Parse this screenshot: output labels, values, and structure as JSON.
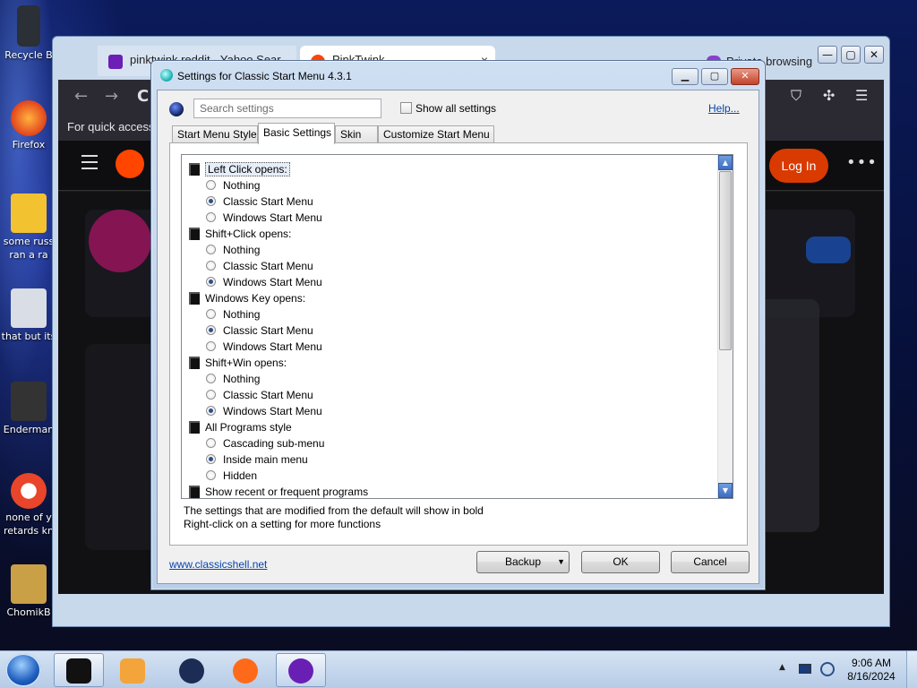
{
  "desktop": {
    "icons": [
      {
        "label": "Recycle B",
        "color": "#2b2f36"
      },
      {
        "label": "Firefox",
        "color": "#ff7a1a"
      },
      {
        "label": "some russ",
        "label2": "ran a ra",
        "color": "#f2c230"
      },
      {
        "label": "that but its",
        "color": "#d8dde6"
      },
      {
        "label": "Enderman",
        "color": "#333333"
      },
      {
        "label": "none of y",
        "label2": "retards kn",
        "color": "#e8452a"
      },
      {
        "label": "ChomikB",
        "color": "#c9a045"
      }
    ]
  },
  "browser": {
    "tab1": {
      "title": "pinktwink reddit - Yahoo Sear",
      "favicon_color": "#6b1fb4"
    },
    "tab2": {
      "title": "PinkTwink",
      "close": "×"
    },
    "private_label": "Private browsing",
    "window_buttons": {
      "minimize": "—",
      "maximize": "▢",
      "close": "✕"
    },
    "nav": {
      "back": "←",
      "forward": "→",
      "reload": "C"
    },
    "quick_access_text": "For quick access,",
    "reddit": {
      "login_label": "Log In",
      "more": "•••",
      "brand_color": "#ff4500"
    }
  },
  "dialog": {
    "title": "Settings for Classic Start Menu 4.3.1",
    "buttons": {
      "minimize": "▁",
      "maximize": "▢",
      "close": "✕"
    },
    "search": {
      "placeholder": "Search settings",
      "value": ""
    },
    "show_all_label": "Show all settings",
    "help_label": "Help...",
    "tabs": [
      {
        "label": "Start Menu Style",
        "active": false
      },
      {
        "label": "Basic Settings",
        "active": true
      },
      {
        "label": "Skin",
        "active": false
      },
      {
        "label": "Customize Start Menu",
        "active": false
      }
    ],
    "settings": [
      {
        "kind": "group",
        "label": "Left Click opens:",
        "selected": true
      },
      {
        "kind": "option",
        "label": "Nothing",
        "checked": false
      },
      {
        "kind": "option",
        "label": "Classic Start Menu",
        "checked": true
      },
      {
        "kind": "option",
        "label": "Windows Start Menu",
        "checked": false
      },
      {
        "kind": "group",
        "label": "Shift+Click opens:"
      },
      {
        "kind": "option",
        "label": "Nothing",
        "checked": false
      },
      {
        "kind": "option",
        "label": "Classic Start Menu",
        "checked": false
      },
      {
        "kind": "option",
        "label": "Windows Start Menu",
        "checked": true
      },
      {
        "kind": "group",
        "label": "Windows Key opens:"
      },
      {
        "kind": "option",
        "label": "Nothing",
        "checked": false
      },
      {
        "kind": "option",
        "label": "Classic Start Menu",
        "checked": true
      },
      {
        "kind": "option",
        "label": "Windows Start Menu",
        "checked": false
      },
      {
        "kind": "group",
        "label": "Shift+Win opens:"
      },
      {
        "kind": "option",
        "label": "Nothing",
        "checked": false
      },
      {
        "kind": "option",
        "label": "Classic Start Menu",
        "checked": false
      },
      {
        "kind": "option",
        "label": "Windows Start Menu",
        "checked": true
      },
      {
        "kind": "group",
        "label": "All Programs style"
      },
      {
        "kind": "option",
        "label": "Cascading sub-menu",
        "checked": false
      },
      {
        "kind": "option",
        "label": "Inside main menu",
        "checked": true
      },
      {
        "kind": "option",
        "label": "Hidden",
        "checked": false
      },
      {
        "kind": "group",
        "label": "Show recent or frequent programs"
      }
    ],
    "scroll_up": "▲",
    "scroll_down": "▼",
    "hint_line1": "The settings that are modified from the default will show in bold",
    "hint_line2": "Right-click on a setting for more functions",
    "site_link": "www.classicshell.net",
    "backup_label": "Backup",
    "backup_arrow": "▼",
    "ok_label": "OK",
    "cancel_label": "Cancel"
  },
  "taskbar": {
    "items": [
      {
        "name": "taskbar-item-terminal",
        "color": "#111111",
        "active": true
      },
      {
        "name": "taskbar-item-media-player",
        "color": "#f3a43a",
        "active": false
      },
      {
        "name": "taskbar-item-globe-app",
        "color": "#1b2d55",
        "active": false
      },
      {
        "name": "taskbar-item-firefox",
        "color": "#ff6a1a",
        "active": false
      },
      {
        "name": "taskbar-item-firefox-private",
        "color": "#6a1fb4",
        "active": true
      }
    ],
    "tray_arrow": "▲",
    "time": "9:06 AM",
    "date": "8/16/2024"
  }
}
